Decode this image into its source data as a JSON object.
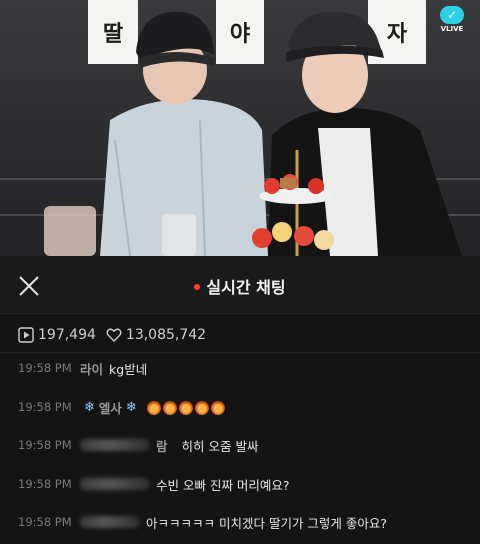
{
  "video": {
    "signs": [
      "딸",
      "야",
      "자"
    ],
    "vlive_label": "VLIVE"
  },
  "header": {
    "title": "실시간 채팅",
    "live_dot_color": "#ff3b3b",
    "close_icon": "close-icon"
  },
  "stats": {
    "views": "197,494",
    "likes": "13,085,742"
  },
  "messages": [
    {
      "time": "19:58 PM",
      "nick": "라이",
      "text": "kg받네"
    },
    {
      "time": "19:58 PM",
      "nick": "엘사",
      "text": ""
    },
    {
      "time": "19:58 PM",
      "nick": "람",
      "text": "히히 오줌 발싸"
    },
    {
      "time": "19:58 PM",
      "nick": "",
      "text": "수빈 오빠 진짜 머리예요?"
    },
    {
      "time": "19:58 PM",
      "nick": "",
      "text": "아ㅋㅋㅋㅋㅋ 미치겠다 딸기가 그렇게 좋아요?"
    }
  ]
}
